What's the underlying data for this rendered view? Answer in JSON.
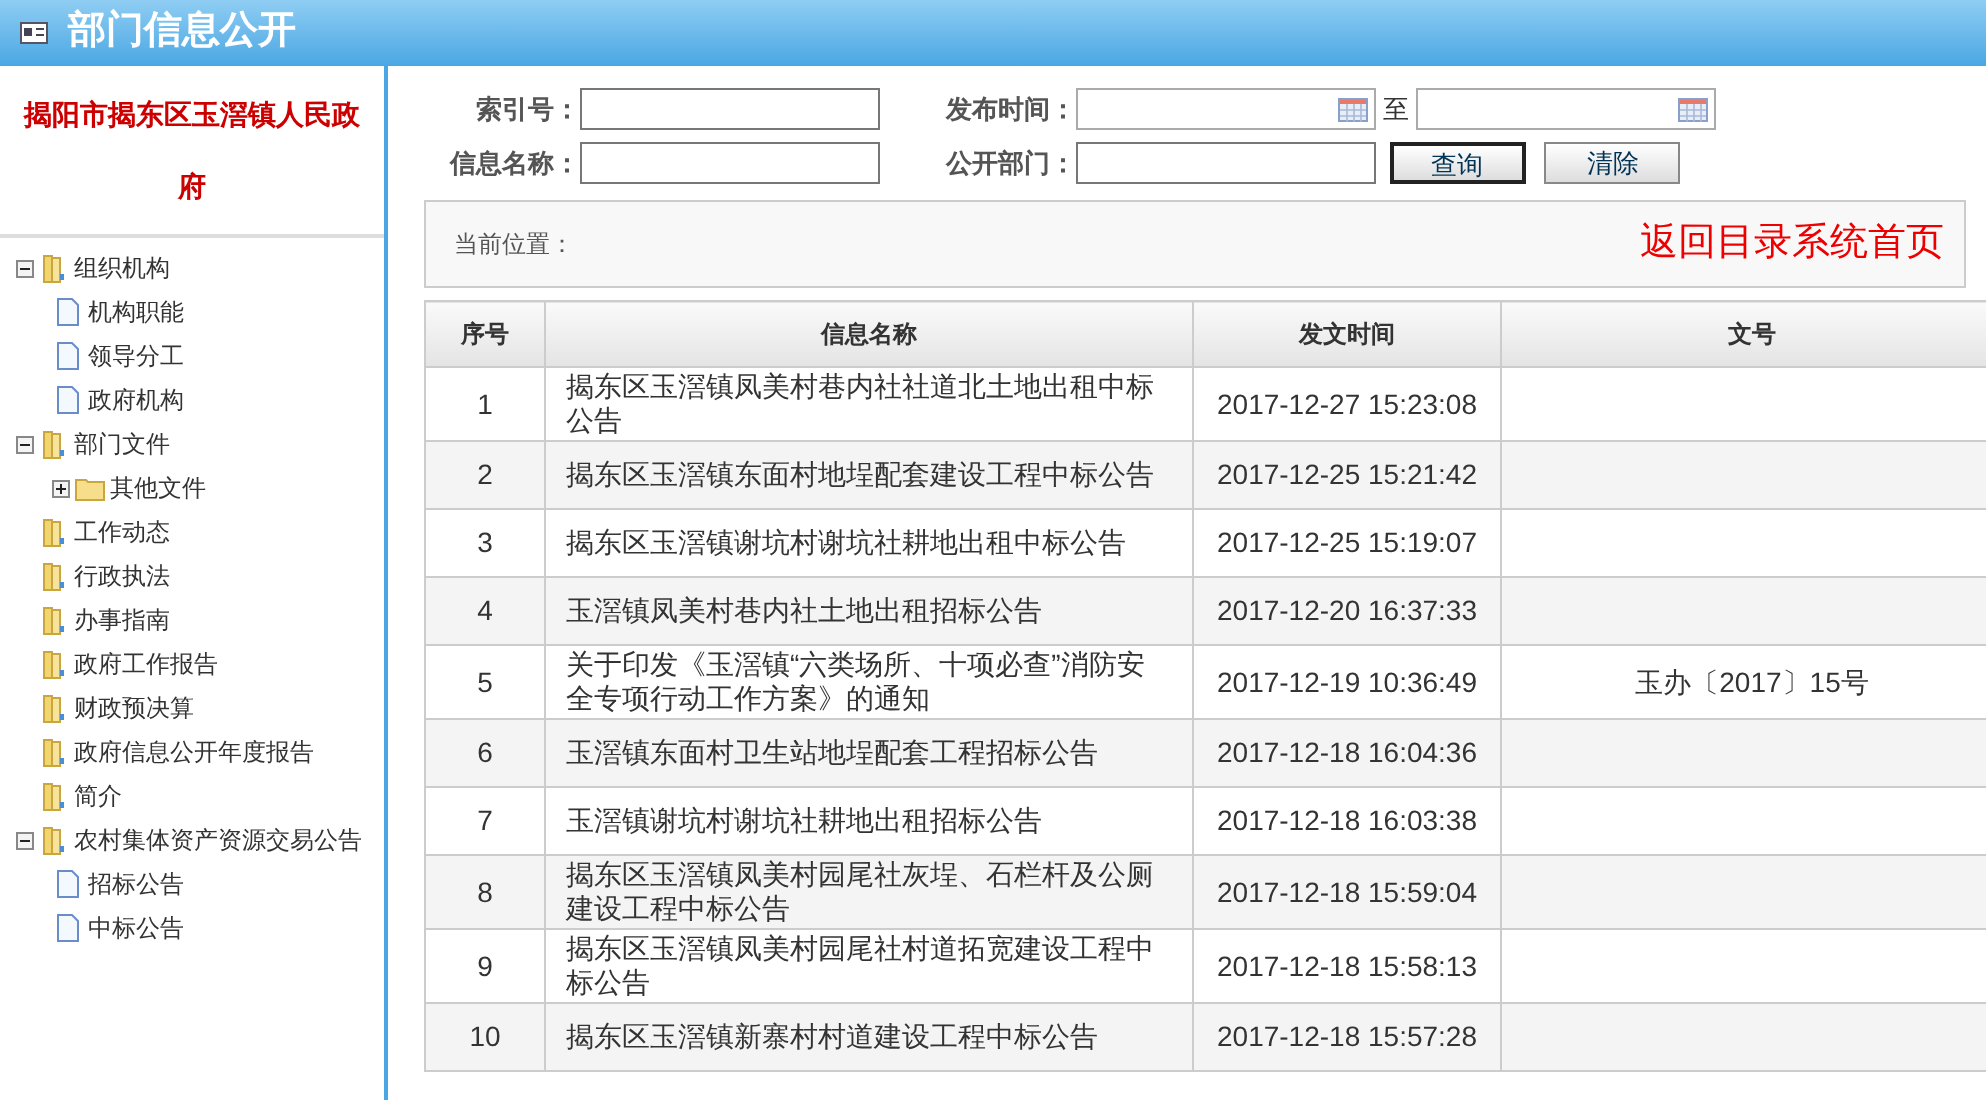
{
  "header": {
    "title": "部门信息公开"
  },
  "sidebar": {
    "org_name": "揭阳市揭东区玉滘镇人民政府",
    "tree": [
      {
        "label": "组织机构",
        "kind": "folder",
        "expanded": true,
        "children": [
          {
            "label": "机构职能",
            "kind": "doc"
          },
          {
            "label": "领导分工",
            "kind": "doc"
          },
          {
            "label": "政府机构",
            "kind": "doc"
          }
        ]
      },
      {
        "label": "部门文件",
        "kind": "folder",
        "expanded": true,
        "children": [
          {
            "label": "其他文件",
            "kind": "subfolder",
            "expanded": false
          }
        ]
      },
      {
        "label": "工作动态",
        "kind": "folder"
      },
      {
        "label": "行政执法",
        "kind": "folder"
      },
      {
        "label": "办事指南",
        "kind": "folder"
      },
      {
        "label": "政府工作报告",
        "kind": "folder"
      },
      {
        "label": "财政预决算",
        "kind": "folder"
      },
      {
        "label": "政府信息公开年度报告",
        "kind": "folder"
      },
      {
        "label": "简介",
        "kind": "folder"
      },
      {
        "label": "农村集体资产资源交易公告",
        "kind": "folder",
        "expanded": true,
        "children": [
          {
            "label": "招标公告",
            "kind": "doc"
          },
          {
            "label": "中标公告",
            "kind": "doc"
          }
        ]
      }
    ]
  },
  "search": {
    "index_label": "索引号：",
    "publish_time_label": "发布时间：",
    "to_label": "至",
    "name_label": "信息名称：",
    "dept_label": "公开部门：",
    "query_button": "查询",
    "clear_button": "清除"
  },
  "location": {
    "label": "当前位置：",
    "home_link": "返回目录系统首页"
  },
  "table": {
    "columns": [
      "序号",
      "信息名称",
      "发文时间",
      "文号"
    ],
    "rows": [
      [
        "1",
        "揭东区玉滘镇凤美村巷内社社道北土地出租中标公告",
        "2017-12-27 15:23:08",
        ""
      ],
      [
        "2",
        "揭东区玉滘镇东面村地埕配套建设工程中标公告",
        "2017-12-25 15:21:42",
        ""
      ],
      [
        "3",
        "揭东区玉滘镇谢坑村谢坑社耕地出租中标公告",
        "2017-12-25 15:19:07",
        ""
      ],
      [
        "4",
        "玉滘镇凤美村巷内社土地出租招标公告",
        "2017-12-20 16:37:33",
        ""
      ],
      [
        "5",
        "关于印发《玉滘镇“六类场所、十项必查”消防安全专项行动工作方案》的通知",
        "2017-12-19 10:36:49",
        "玉办〔2017〕15号"
      ],
      [
        "6",
        "玉滘镇东面村卫生站地埕配套工程招标公告",
        "2017-12-18 16:04:36",
        ""
      ],
      [
        "7",
        "玉滘镇谢坑村谢坑社耕地出租招标公告",
        "2017-12-18 16:03:38",
        ""
      ],
      [
        "8",
        "揭东区玉滘镇凤美村园尾社灰埕、石栏杆及公厕建设工程中标公告",
        "2017-12-18 15:59:04",
        ""
      ],
      [
        "9",
        "揭东区玉滘镇凤美村园尾社村道拓宽建设工程中标公告",
        "2017-12-18 15:58:13",
        ""
      ],
      [
        "10",
        "揭东区玉滘镇新寨村村道建设工程中标公告",
        "2017-12-18 15:57:28",
        ""
      ]
    ]
  }
}
